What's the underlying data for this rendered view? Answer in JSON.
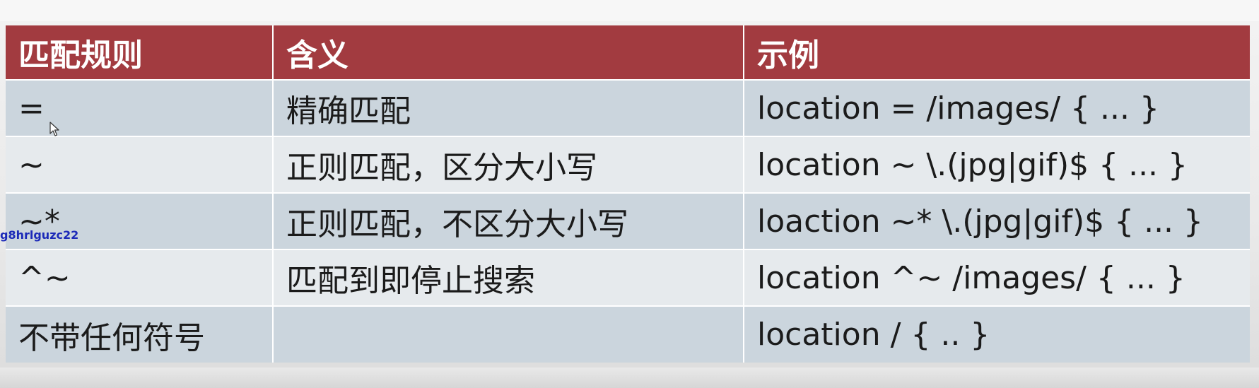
{
  "table": {
    "headers": [
      "匹配规则",
      "含义",
      "示例"
    ],
    "rows": [
      {
        "rule": "=",
        "meaning": "精确匹配",
        "example": "location = /images/ { ... }"
      },
      {
        "rule": "~",
        "meaning": "正则匹配，区分大小写",
        "example": "location ~ \\.(jpg|gif)$ { ... }"
      },
      {
        "rule": "~*",
        "meaning": "正则匹配，不区分大小写",
        "example": "loaction ~* \\.(jpg|gif)$ { ... }"
      },
      {
        "rule": "^~",
        "meaning": "匹配到即停止搜索",
        "example": "location ^~ /images/ { ... }"
      },
      {
        "rule": "不带任何符号",
        "meaning": "",
        "example": "location / { .. }"
      }
    ]
  },
  "watermark": "g8hrlguzc22",
  "colors": {
    "header_bg": "#a23b40",
    "header_text": "#ffffff",
    "row_odd_bg": "#cbd5dd",
    "row_even_bg": "#e6eaed",
    "watermark": "#1c2ab8"
  },
  "icons": {
    "cursor": "mouse-pointer-icon"
  }
}
